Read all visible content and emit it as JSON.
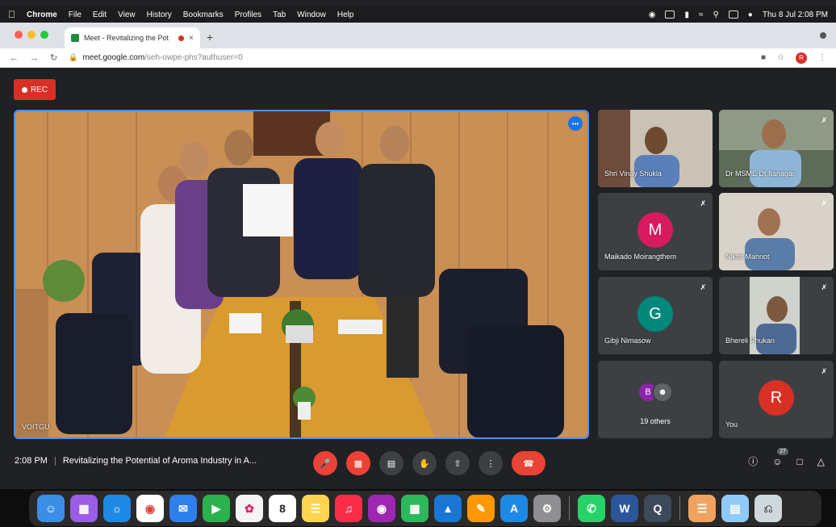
{
  "menubar": {
    "apple": "",
    "items": [
      "Chrome",
      "File",
      "Edit",
      "View",
      "History",
      "Bookmarks",
      "Profiles",
      "Tab",
      "Window",
      "Help"
    ],
    "clock": "Thu 8 Jul 2:08 PM"
  },
  "browser": {
    "tab_title": "Meet - Revitalizing the Pot",
    "tab_close": "×",
    "new_tab": "+",
    "url_host": "meet.google.com",
    "url_path": "/seh-owpe-phs?authuser=0",
    "profile_initial": "R"
  },
  "meet": {
    "rec_label": "REC",
    "main_speaker": "VOITGU",
    "tiles": [
      {
        "name": "Shri Vinay Shukla",
        "type": "video"
      },
      {
        "name": "Dr MSME Dt Itanagar",
        "type": "video"
      },
      {
        "name": "Maikado Moirangthem",
        "type": "avatar",
        "initial": "M",
        "color": "#d81b60"
      },
      {
        "name": "Nikhil Mahnot",
        "type": "video"
      },
      {
        "name": "Gibji Nimasow",
        "type": "avatar",
        "initial": "G",
        "color": "#00897b"
      },
      {
        "name": "Bhereli Phukan",
        "type": "video"
      },
      {
        "name": "19 others",
        "type": "others",
        "initial": "B",
        "color": "#8e24aa"
      },
      {
        "name": "You",
        "type": "avatar",
        "initial": "R",
        "color": "#d93025"
      }
    ],
    "time": "2:08 PM",
    "meeting_title": "Revitalizing the Potential of Aroma Industry in A...",
    "participant_count": "27"
  },
  "dock": {
    "calendar_day": "8",
    "apps": [
      "finder",
      "launchpad",
      "safari",
      "chrome",
      "mail",
      "facetime",
      "photos",
      "calendar",
      "notes",
      "music",
      "podcasts",
      "numbers",
      "keynote",
      "pages",
      "app-store",
      "system-preferences",
      "whatsapp",
      "word",
      "quicktime",
      "downloads",
      "files",
      "trash"
    ]
  }
}
